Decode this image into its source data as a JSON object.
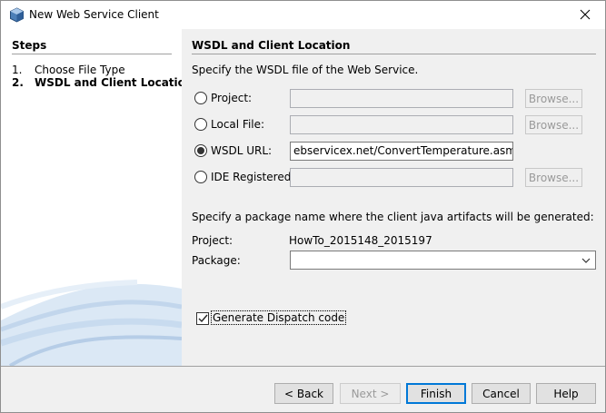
{
  "window": {
    "title": "New Web Service Client"
  },
  "steps": {
    "title": "Steps",
    "items": [
      {
        "num": "1.",
        "label": "Choose File Type"
      },
      {
        "num": "2.",
        "label": "WSDL and Client Location"
      }
    ]
  },
  "content": {
    "title": "WSDL and Client Location",
    "intro": "Specify the WSDL file of the Web Service.",
    "options": {
      "project": {
        "label": "Project:",
        "value": "",
        "browse": "Browse..."
      },
      "local_file": {
        "label": "Local File:",
        "value": "",
        "browse": "Browse..."
      },
      "wsdl_url": {
        "label": "WSDL URL:",
        "value": "ebservicex.net/ConvertTemperature.asmx?WSDL"
      },
      "ide_registered": {
        "label": "IDE Registered:",
        "value": "",
        "browse": "Browse..."
      }
    },
    "selected_option": "wsdl_url",
    "package_intro": "Specify a package name where the client java artifacts will be generated:",
    "project_label": "Project:",
    "project_value": "HowTo_2015148_2015197",
    "package_label": "Package:",
    "package_value": "",
    "dispatch_label": "Generate Dispatch code",
    "dispatch_checked": true
  },
  "buttons": {
    "back": "< Back",
    "next": "Next >",
    "finish": "Finish",
    "cancel": "Cancel",
    "help": "Help"
  }
}
